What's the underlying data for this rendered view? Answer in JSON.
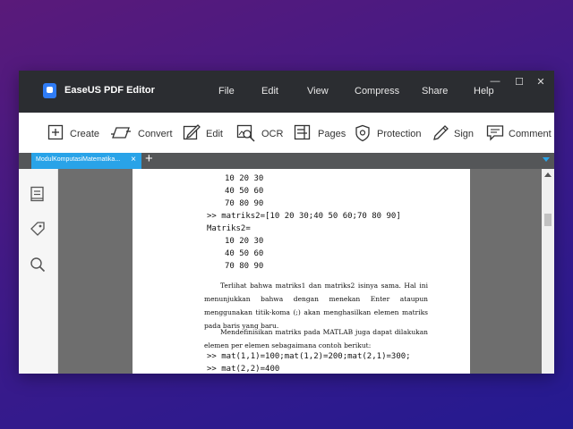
{
  "app": {
    "title": "EaseUS PDF Editor"
  },
  "menu": [
    "File",
    "Edit",
    "View",
    "Compress",
    "Share",
    "Help"
  ],
  "window_controls": {
    "minimize": "—",
    "maximize": "☐",
    "close": "✕"
  },
  "toolbar": [
    "Create",
    "Convert",
    "Edit",
    "OCR",
    "Pages",
    "Protection",
    "Sign",
    "Comment"
  ],
  "tab": {
    "label": "ModulKomputasiMatematika...",
    "close": "×",
    "add": "+"
  },
  "sidebar_icons": [
    "bookmark-icon",
    "tag-icon",
    "search-icon"
  ],
  "document": {
    "code1": [
      "10 20 30",
      "40 50 60",
      "70 80 90"
    ],
    "cmd1": ">> matriks2=[10 20 30;40 50 60;70 80 90]",
    "var": "Matriks2=",
    "code2": [
      "10 20 30",
      "40 50 60",
      "70 80 90"
    ],
    "para1": "Terlihat bahwa matriks1 dan matriks2 isinya sama. Hal ini menunjukkan bahwa dengan menekan Enter ataupun menggunakan titik-koma (;) akan menghasilkan elemen matriks pada baris yang baru.",
    "para2": "Mendefinisikan matriks pada MATLAB juga dapat dilakukan elemen per elemen sebagaimana contoh berikut:",
    "cmd2": ">> mat(1,1)=100;mat(1,2)=200;mat(2,1)=300;",
    "cmd3": ">> mat(2,2)=400"
  },
  "colors": {
    "titlebar": "#2b2d31",
    "tab": "#29a3e8",
    "canvas": "#6e6e6e"
  }
}
